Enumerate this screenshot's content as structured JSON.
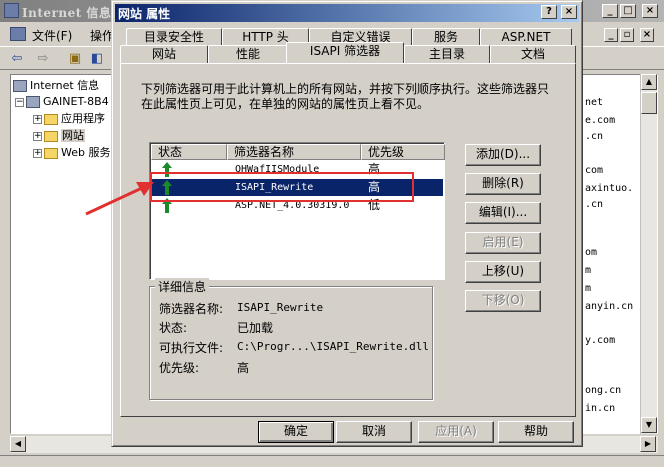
{
  "background_window": {
    "title": "Internet 信息",
    "menu": [
      "文件(F)",
      "操作"
    ],
    "tree": [
      {
        "label": "Internet 信息"
      },
      {
        "label": "GAINET-8B4"
      },
      {
        "label": "应用程序"
      },
      {
        "label": "网站"
      },
      {
        "label": "Web 服务"
      }
    ],
    "list_fragments": [
      "net",
      "e.com",
      ".cn",
      "com",
      "axintuo.",
      ".cn",
      "om",
      "m",
      "m",
      "anyin.cn",
      "y.com",
      "ong.cn",
      "in.cn"
    ]
  },
  "dialog": {
    "title": "网站 属性",
    "title_buttons": [
      "?",
      "×"
    ],
    "tabs_row1": [
      "目录安全性",
      "HTTP 头",
      "自定义错误",
      "服务",
      "ASP.NET"
    ],
    "tabs_row2": [
      "网站",
      "性能",
      "ISAPI 筛选器",
      "主目录",
      "文档"
    ],
    "active_tab": "ISAPI 筛选器",
    "description": "下列筛选器可用于此计算机上的所有网站，并按下列顺序执行。这些筛选器只在此属性页上可见，在单独的网站的属性页上看不见。",
    "list_headers": [
      "状态",
      "筛选器名称",
      "优先级"
    ],
    "filters": [
      {
        "name": "QHWafIISModule",
        "priority": "高"
      },
      {
        "name": "ISAPI_Rewrite",
        "priority": "高"
      },
      {
        "name": "ASP.NET_4.0.30319.0",
        "priority": "低"
      }
    ],
    "side_buttons": {
      "add": "添加(D)...",
      "remove": "删除(R)",
      "edit": "编辑(I)...",
      "enable": "启用(E)",
      "move_up": "上移(U)",
      "move_down": "下移(O)"
    },
    "details": {
      "legend": "详细信息",
      "name_label": "筛选器名称:",
      "name_value": "ISAPI_Rewrite",
      "status_label": "状态:",
      "status_value": "已加载",
      "exe_label": "可执行文件:",
      "exe_value": "C:\\Progr...\\ISAPI_Rewrite.dll",
      "priority_label": "优先级:",
      "priority_value": "高"
    },
    "bottom_buttons": {
      "ok": "确定",
      "cancel": "取消",
      "apply": "应用(A)",
      "help": "帮助"
    },
    "colors": {
      "title_gradient_start": "#0a246a",
      "selection": "#0a246a",
      "status_arrow": "#1a8a2a",
      "annotation": "#e03030"
    }
  }
}
